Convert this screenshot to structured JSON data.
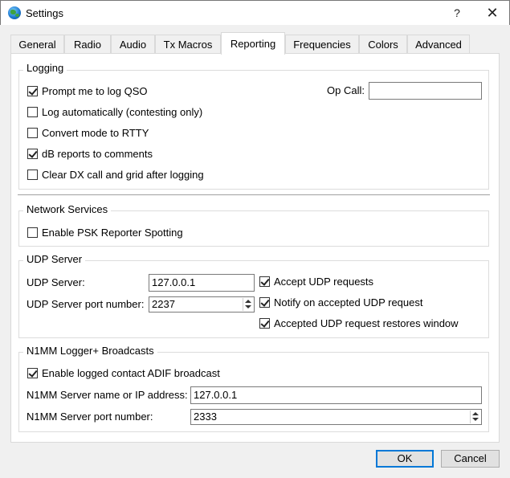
{
  "window": {
    "title": "Settings",
    "help_label": "?",
    "close_label": "✕"
  },
  "tabs": [
    {
      "label": "General",
      "active": false
    },
    {
      "label": "Radio",
      "active": false
    },
    {
      "label": "Audio",
      "active": false
    },
    {
      "label": "Tx Macros",
      "active": false
    },
    {
      "label": "Reporting",
      "active": true
    },
    {
      "label": "Frequencies",
      "active": false
    },
    {
      "label": "Colors",
      "active": false
    },
    {
      "label": "Advanced",
      "active": false
    }
  ],
  "logging": {
    "title": "Logging",
    "prompt_log_qso": {
      "label": "Prompt me to log QSO",
      "checked": true
    },
    "log_automatically": {
      "label": "Log automatically (contesting only)",
      "checked": false
    },
    "convert_mode": {
      "label": "Convert mode to RTTY",
      "checked": false
    },
    "db_reports": {
      "label": "dB reports to comments",
      "checked": true
    },
    "clear_dx": {
      "label": "Clear DX call and grid after logging",
      "checked": false
    },
    "op_call_label": "Op Call:",
    "op_call_value": ""
  },
  "network_services": {
    "title": "Network Services",
    "psk_reporter": {
      "label": "Enable PSK Reporter Spotting",
      "checked": false
    }
  },
  "udp_server": {
    "title": "UDP Server",
    "server_label": "UDP Server:",
    "server_value": "127.0.0.1",
    "port_label": "UDP Server port number:",
    "port_value": "2237",
    "accept_requests": {
      "label": "Accept UDP requests",
      "checked": true
    },
    "notify_accepted": {
      "label": "Notify on accepted UDP request",
      "checked": true
    },
    "restores_window": {
      "label": "Accepted UDP request restores window",
      "checked": true
    }
  },
  "n1mm": {
    "title": "N1MM Logger+  Broadcasts",
    "adif_broadcast": {
      "label": "Enable logged contact ADIF broadcast",
      "checked": true
    },
    "server_label": "N1MM Server name or IP address:",
    "server_value": "127.0.0.1",
    "port_label": "N1MM Server port number:",
    "port_value": "2333"
  },
  "buttons": {
    "ok_label": "OK",
    "cancel_label": "Cancel"
  }
}
